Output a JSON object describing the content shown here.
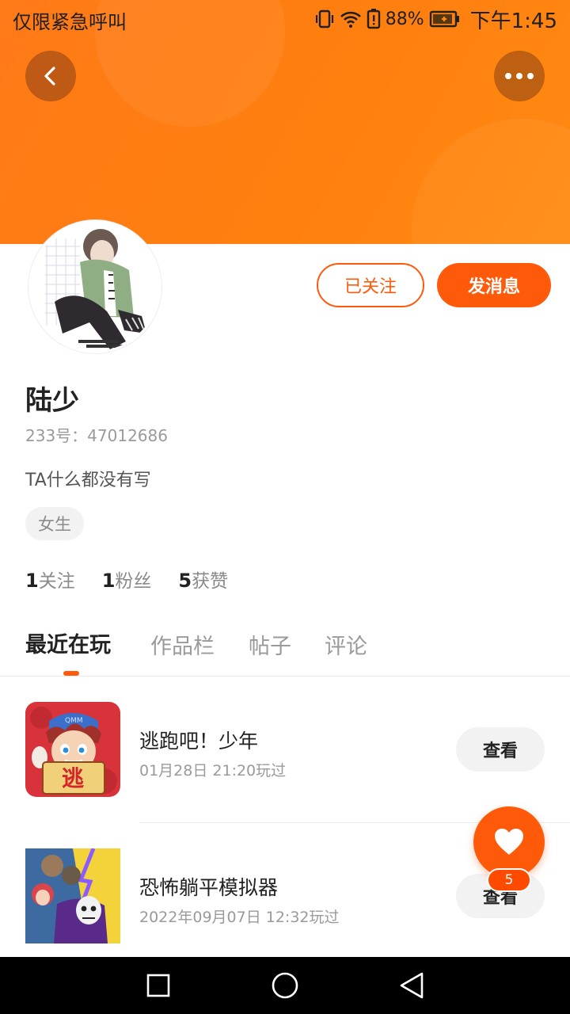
{
  "status_bar": {
    "carrier_text": "仅限紧急呼叫",
    "battery_percent": "88%",
    "time": "下午1:45",
    "icons": [
      "vibrate-icon",
      "wifi-icon",
      "battery-alert-icon",
      "battery-charging-icon"
    ]
  },
  "header": {
    "back_icon": "chevron-left-icon",
    "more_icon": "more-dots-icon",
    "accent_color": "#ff7a18"
  },
  "profile": {
    "follow_button": "已关注",
    "message_button": "发消息",
    "name": "陆少",
    "id_text": "233号：47012686",
    "bio": "TA什么都没有写",
    "gender_tag": "女生",
    "stats": [
      {
        "count": "1",
        "label": "关注"
      },
      {
        "count": "1",
        "label": "粉丝"
      },
      {
        "count": "5",
        "label": "获赞"
      }
    ]
  },
  "tabs": [
    {
      "label": "最近在玩",
      "active": true
    },
    {
      "label": "作品栏",
      "active": false
    },
    {
      "label": "帖子",
      "active": false
    },
    {
      "label": "评论",
      "active": false
    }
  ],
  "games": [
    {
      "name": "逃跑吧！少年",
      "played": "01月28日 21:20玩过",
      "action": "查看",
      "icon_text": "逃",
      "icon_badge": "QMM"
    },
    {
      "name": "恐怖躺平模拟器",
      "played": "2022年09月07日 12:32玩过",
      "action": "查看"
    }
  ],
  "like_fab": {
    "icon": "heart-icon",
    "count": "5"
  },
  "nav_bar": {
    "icons": [
      "recent-apps-icon",
      "home-icon",
      "back-triangle-icon"
    ]
  },
  "colors": {
    "primary": "#ff5a0a",
    "text": "#222222",
    "muted": "#9a9a9a"
  }
}
